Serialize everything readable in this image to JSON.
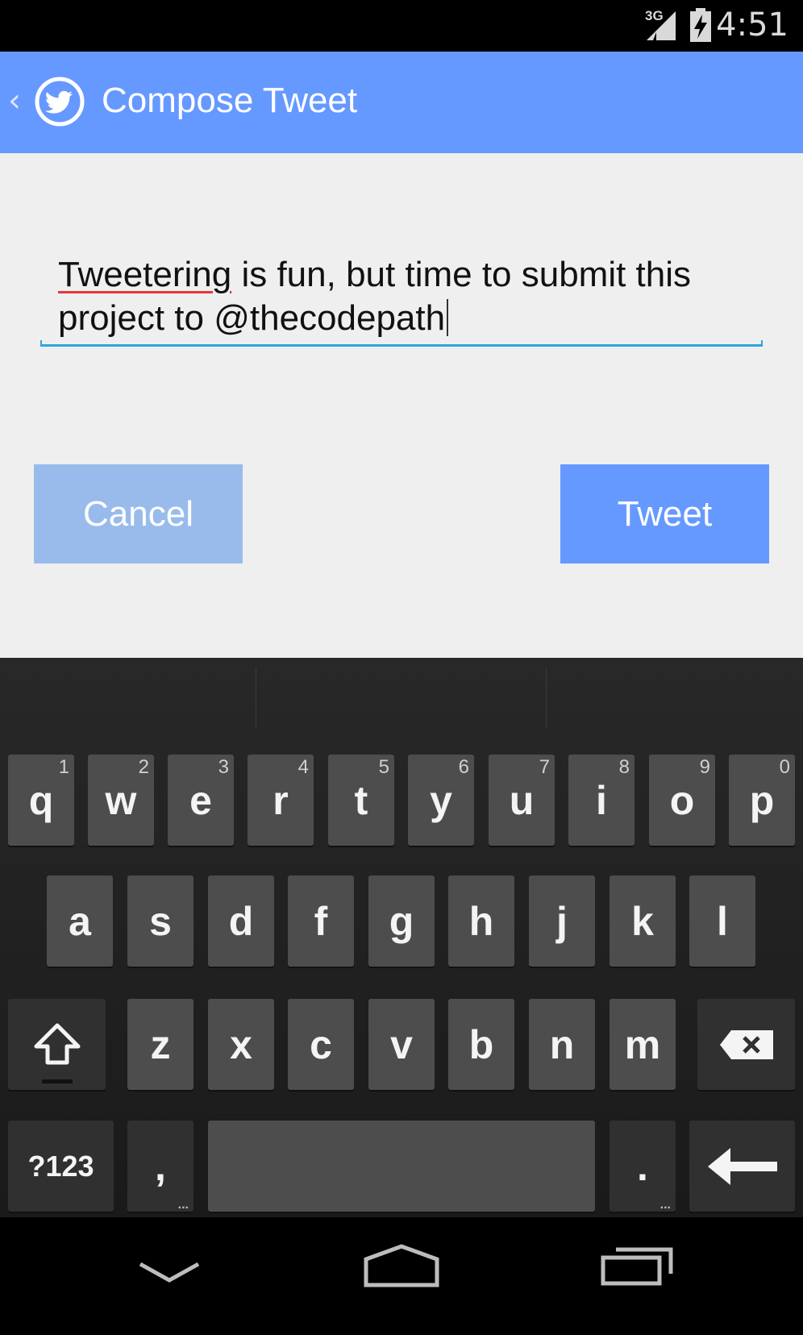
{
  "status_bar": {
    "network": "3G",
    "time": "4:51"
  },
  "action_bar": {
    "title": "Compose Tweet"
  },
  "compose": {
    "text_word1": "Tweetering",
    "text_rest": " is fun, but time to submit this project to @thecodepath"
  },
  "buttons": {
    "cancel": "Cancel",
    "tweet": "Tweet"
  },
  "keyboard": {
    "row1": [
      {
        "letter": "q",
        "hint": "1"
      },
      {
        "letter": "w",
        "hint": "2"
      },
      {
        "letter": "e",
        "hint": "3"
      },
      {
        "letter": "r",
        "hint": "4"
      },
      {
        "letter": "t",
        "hint": "5"
      },
      {
        "letter": "y",
        "hint": "6"
      },
      {
        "letter": "u",
        "hint": "7"
      },
      {
        "letter": "i",
        "hint": "8"
      },
      {
        "letter": "o",
        "hint": "9"
      },
      {
        "letter": "p",
        "hint": "0"
      }
    ],
    "row2": [
      "a",
      "s",
      "d",
      "f",
      "g",
      "h",
      "j",
      "k",
      "l"
    ],
    "row3": [
      "z",
      "x",
      "c",
      "v",
      "b",
      "n",
      "m"
    ],
    "symbols": "?123",
    "comma": ",",
    "period": "."
  },
  "colors": {
    "action_bar": "#6699ff",
    "tweet_button": "#6699ff",
    "cancel_button": "#99bbec",
    "input_underline": "#2aa7d8",
    "spellcheck_underline": "#e53935"
  },
  "icons": {
    "back": "chevron-left-icon",
    "app": "twitter-bird-icon",
    "shift": "shift-arrow-icon",
    "backspace": "backspace-icon",
    "enter": "enter-arrow-icon",
    "nav_back": "nav-back-icon",
    "nav_home": "nav-home-icon",
    "nav_recents": "nav-recents-icon"
  }
}
